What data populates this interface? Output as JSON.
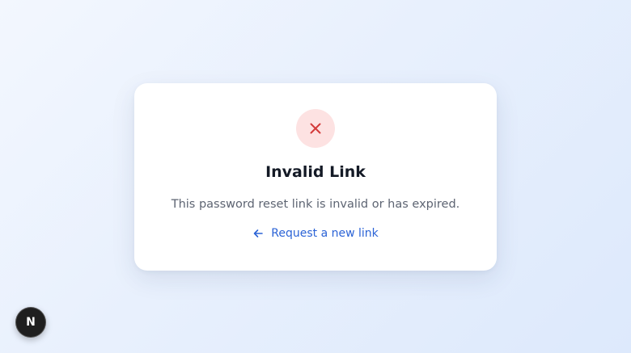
{
  "card": {
    "status_icon": "x-icon",
    "status_color": "#d33a3a",
    "status_bg": "#fde2e2",
    "title": "Invalid Link",
    "message": "This password reset link is invalid or has expired.",
    "link": {
      "icon": "arrow-left-icon",
      "label": "Request a new link",
      "color": "#2b63d6"
    }
  },
  "fab": {
    "icon": "next-logo-icon",
    "label": "N"
  }
}
